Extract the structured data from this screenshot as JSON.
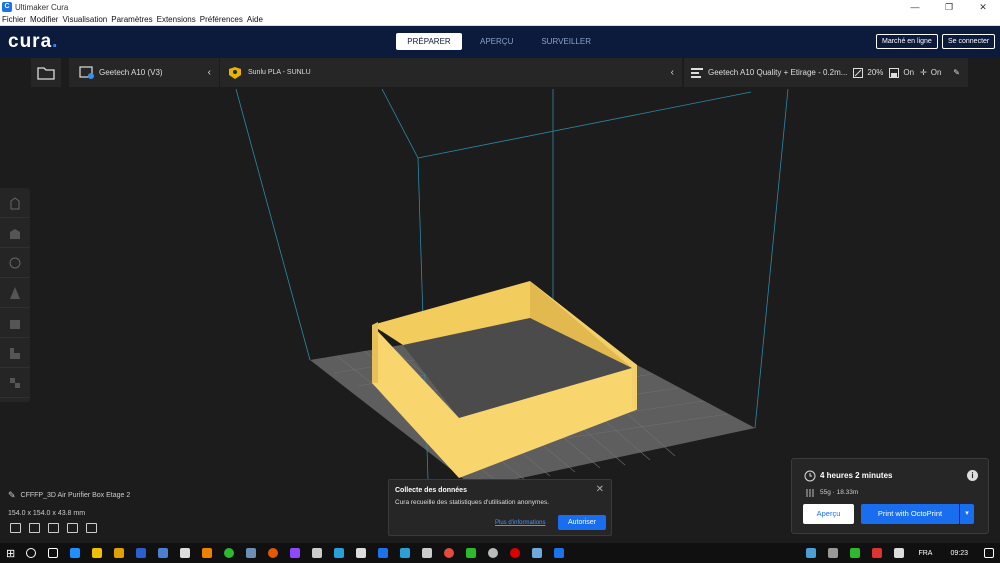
{
  "window": {
    "title": "Ultimaker Cura"
  },
  "menu": [
    "Fichier",
    "Modifier",
    "Visualisation",
    "Paramètres",
    "Extensions",
    "Préférences",
    "Aide"
  ],
  "stages": [
    "PRÉPARER",
    "APERÇU",
    "SURVEILLER"
  ],
  "header_buttons": {
    "marketplace": "Marché en ligne",
    "signin": "Se connecter"
  },
  "printer": {
    "name": "Geetech A10 (V3)"
  },
  "material": {
    "name": "Sunlu PLA - SUNLU"
  },
  "profile": {
    "name": "Geetech A10 Quality + Etirage - 0.2m...",
    "infill": "20%",
    "support": "On",
    "adhesion": "On"
  },
  "object": {
    "name": "CFFFP_3D Air Purifier Box Etage 2",
    "dimensions": "154.0 x 154.0 x 43.8 mm"
  },
  "toast": {
    "title": "Collecte des données",
    "message": "Cura recueille des statistiques d'utilisation anonymes.",
    "more_info": "Plus d'informations",
    "allow": "Autoriser"
  },
  "print": {
    "time": "4 heures 2 minutes",
    "material": "55g · 18.33m",
    "preview": "Aperçu",
    "action": "Print with OctoPrint"
  },
  "taskbar": {
    "lang": "FRA",
    "time": "09:23"
  },
  "colors": {
    "header": "#0c1a3b",
    "accent": "#196ef0",
    "model": "#f9d56e"
  }
}
